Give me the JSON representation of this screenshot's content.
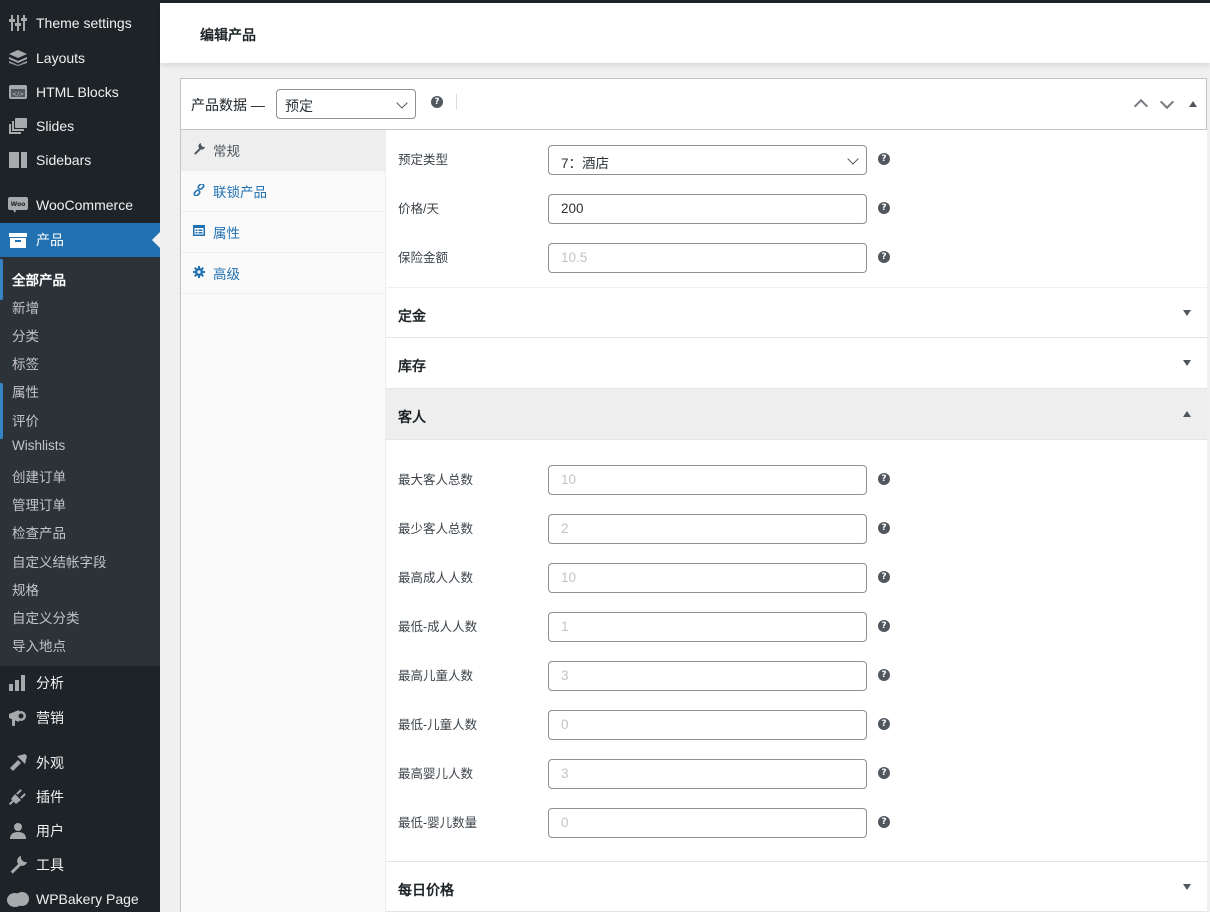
{
  "sidebar": {
    "top_items": [
      {
        "label": "Theme settings",
        "icon": "sliders-icon"
      },
      {
        "label": "Layouts",
        "icon": "layers-icon"
      },
      {
        "label": "HTML Blocks",
        "icon": "code-block-icon"
      },
      {
        "label": "Slides",
        "icon": "slides-icon"
      },
      {
        "label": "Sidebars",
        "icon": "sidebar-icon"
      },
      {
        "label": "WooCommerce",
        "icon": "woo-icon"
      }
    ],
    "active_item": {
      "label": "产品",
      "icon": "archive-icon"
    },
    "submenu": [
      "全部产品",
      "新增",
      "分类",
      "标签",
      "属性",
      "评价",
      "Wishlists",
      "创建订单",
      "管理订单",
      "检查产品",
      "自定义结帐字段",
      "规格",
      "自定义分类",
      "导入地点"
    ],
    "bottom_items": [
      {
        "label": "分析",
        "icon": "bar-chart-icon"
      },
      {
        "label": "营销",
        "icon": "megaphone-icon"
      },
      {
        "label": "外观",
        "icon": "paintbrush-icon"
      },
      {
        "label": "插件",
        "icon": "plug-icon"
      },
      {
        "label": "用户",
        "icon": "user-icon"
      },
      {
        "label": "工具",
        "icon": "wrench-icon"
      },
      {
        "label": "WPBakery Page",
        "icon": "cloud-icon"
      }
    ]
  },
  "header": {
    "title": "编辑产品"
  },
  "panel": {
    "title": "产品数据 —",
    "product_type": "预定",
    "help": "?"
  },
  "tabs": [
    {
      "label": "常规",
      "icon": "wrench-icon",
      "glyph": "🔧"
    },
    {
      "label": "联锁产品",
      "icon": "link-icon",
      "glyph": "🔗"
    },
    {
      "label": "属性",
      "icon": "list-card-icon",
      "glyph": "▤"
    },
    {
      "label": "高级",
      "icon": "gear-icon",
      "glyph": "⚙"
    }
  ],
  "general_fields": [
    {
      "label": "预定类型",
      "value": "7：酒店",
      "type": "select"
    },
    {
      "label": "价格/天",
      "value": "200",
      "type": "text"
    },
    {
      "label": "保险金额",
      "placeholder": "10.5",
      "type": "text"
    }
  ],
  "sections": {
    "deposit": "定金",
    "inventory": "库存",
    "guests": "客人",
    "daily_price": "每日价格"
  },
  "guest_fields": [
    {
      "label": "最大客人总数",
      "placeholder": "10"
    },
    {
      "label": "最少客人总数",
      "placeholder": "2"
    },
    {
      "label": "最高成人人数",
      "placeholder": "10"
    },
    {
      "label": "最低-成人人数",
      "placeholder": "1"
    },
    {
      "label": "最高儿童人数",
      "placeholder": "3"
    },
    {
      "label": "最低-儿童人数",
      "placeholder": "0"
    },
    {
      "label": "最高婴儿人数",
      "placeholder": "3"
    },
    {
      "label": "最低-婴儿数量",
      "placeholder": "0"
    }
  ]
}
